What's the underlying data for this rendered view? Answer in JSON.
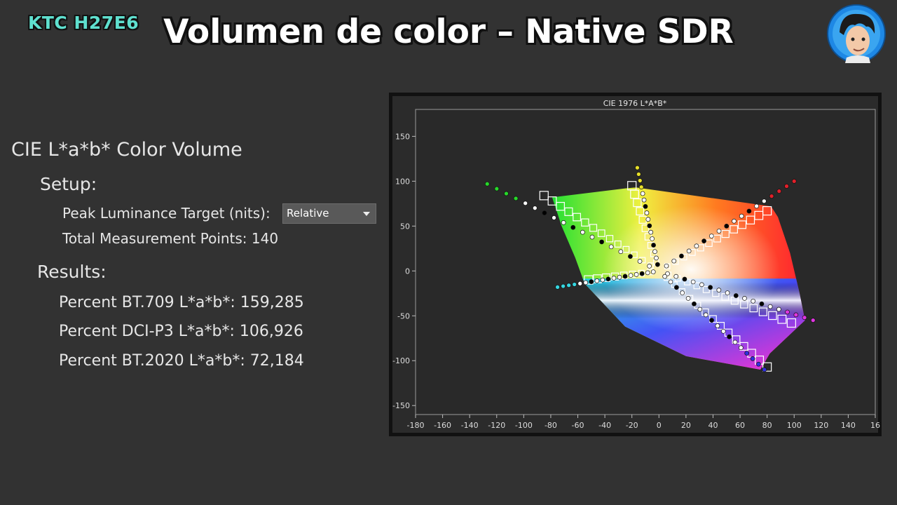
{
  "header": {
    "brand": "KTC H27E6",
    "title": "Volumen de color – Native SDR"
  },
  "panel": {
    "heading": "CIE L*a*b* Color Volume",
    "setup_label": "Setup:",
    "peak_label": "Peak Luminance Target (nits):",
    "peak_value": "Relative",
    "points_label": "Total Measurement Points: 140",
    "results_label": "Results:",
    "results": [
      "Percent BT.709 L*a*b*: 159,285",
      "Percent DCI-P3 L*a*b*: 106,926",
      "Percent BT.2020 L*a*b*: 72,184"
    ]
  },
  "chart_data": {
    "type": "scatter",
    "title": "CIE 1976 L*A*B*",
    "xlim": [
      -180,
      160
    ],
    "ylim": [
      -160,
      180
    ],
    "x_ticks": [
      "-180",
      "-160",
      "-140",
      "-120",
      "-100",
      "-80",
      "-60",
      "-40",
      "-20",
      "0",
      "20",
      "40",
      "60",
      "80",
      "100",
      "120",
      "140",
      "16"
    ],
    "y_ticks": [
      "150",
      "100",
      "50",
      "0",
      "-50",
      "-100",
      "-150"
    ],
    "grid": false,
    "gamut_polygon": [
      {
        "a": -79,
        "b": 82
      },
      {
        "a": -25,
        "b": 92
      },
      {
        "a": -17,
        "b": 93
      },
      {
        "a": 83,
        "b": 72
      },
      {
        "a": 88,
        "b": 60
      },
      {
        "a": 97,
        "b": 20
      },
      {
        "a": 104,
        "b": -25
      },
      {
        "a": 108,
        "b": -55
      },
      {
        "a": 82,
        "b": -92
      },
      {
        "a": 75,
        "b": -110
      },
      {
        "a": 20,
        "b": -95
      },
      {
        "a": -25,
        "b": -62
      },
      {
        "a": -55,
        "b": -14
      },
      {
        "a": -62,
        "b": 15
      },
      {
        "a": -72,
        "b": 50
      }
    ],
    "series": [
      {
        "color": "#27d82a",
        "from": [
          -127,
          97
        ],
        "to": [
          0,
          0
        ],
        "n": 18
      },
      {
        "color": "#e8e02a",
        "from": [
          -16,
          115
        ],
        "to": [
          0,
          0
        ],
        "n": 16
      },
      {
        "color": "#e0202a",
        "from": [
          100,
          100
        ],
        "to": [
          0,
          0
        ],
        "n": 18
      },
      {
        "color": "#e036e0",
        "from": [
          114,
          -55
        ],
        "to": [
          0,
          0
        ],
        "n": 18
      },
      {
        "color": "#3030e0",
        "from": [
          78,
          -110
        ],
        "to": [
          0,
          0
        ],
        "n": 18
      },
      {
        "color": "#36d6e0",
        "from": [
          -75,
          -18
        ],
        "to": [
          0,
          0
        ],
        "n": 18
      }
    ],
    "target_boxes": [
      {
        "from": [
          -85,
          84
        ],
        "to": [
          0,
          0
        ],
        "n": 14
      },
      {
        "from": [
          -20,
          95
        ],
        "to": [
          0,
          0
        ],
        "n": 10
      },
      {
        "from": [
          80,
          67
        ],
        "to": [
          0,
          0
        ],
        "n": 13
      },
      {
        "from": [
          98,
          -58
        ],
        "to": [
          0,
          0
        ],
        "n": 14
      },
      {
        "from": [
          80,
          -107
        ],
        "to": [
          0,
          0
        ],
        "n": 14
      },
      {
        "from": [
          -52,
          -10
        ],
        "to": [
          0,
          0
        ],
        "n": 8
      }
    ]
  }
}
